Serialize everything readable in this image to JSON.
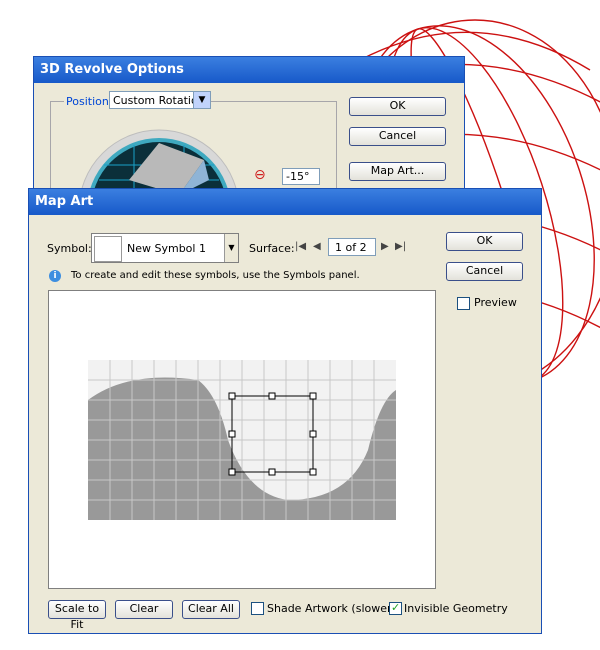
{
  "revolve": {
    "title": "3D Revolve Options",
    "position_label": "Position:",
    "position_value": "Custom Rotation",
    "angle_value": "-15°",
    "ok_label": "OK",
    "cancel_label": "Cancel",
    "map_art_label": "Map Art..."
  },
  "map_art": {
    "title": "Map Art",
    "symbol_label": "Symbol:",
    "symbol_value": "New Symbol 1",
    "surface_label": "Surface:",
    "surface_value": "1 of 2",
    "info_text": "To create and edit these symbols, use the Symbols panel.",
    "ok_label": "OK",
    "cancel_label": "Cancel",
    "preview_label": "Preview",
    "scale_to_fit_label": "Scale to Fit",
    "clear_label": "Clear",
    "clear_all_label": "Clear All",
    "shade_artwork_label": "Shade Artwork (slower)",
    "invisible_geometry_label": "Invisible Geometry",
    "preview_checked": false,
    "shade_checked": false,
    "invisible_checked": true
  },
  "colors": {
    "titlebar": "#1759c9",
    "dialog_bg": "#ece9d8",
    "wireframe": "#cc0000",
    "surface_gray": "#999999"
  },
  "icons": [
    "chevron-down-icon",
    "rotation-icon",
    "first-surface-icon",
    "previous-surface-icon",
    "next-surface-icon",
    "last-surface-icon",
    "info-icon",
    "checkmark-icon"
  ]
}
